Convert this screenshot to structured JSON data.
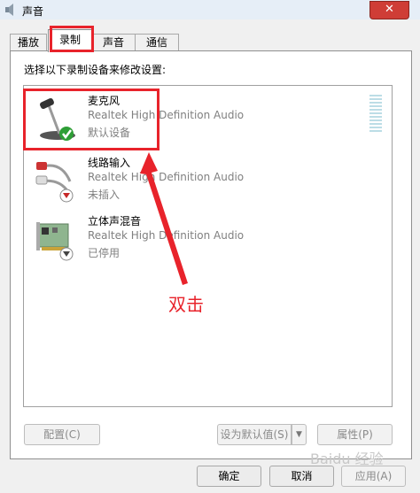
{
  "window": {
    "title": "声音",
    "close_label": "✕"
  },
  "tabs": [
    {
      "label": "播放"
    },
    {
      "label": "录制"
    },
    {
      "label": "声音"
    },
    {
      "label": "通信"
    }
  ],
  "panel": {
    "instruction": "选择以下录制设备来修改设置:"
  },
  "devices": [
    {
      "name": "麦克风",
      "driver": "Realtek High Definition Audio",
      "status": "默认设备"
    },
    {
      "name": "线路输入",
      "driver": "Realtek High Definition Audio",
      "status": "未插入"
    },
    {
      "name": "立体声混音",
      "driver": "Realtek High Definition Audio",
      "status": "已停用"
    }
  ],
  "buttons": {
    "configure": "配置(C)",
    "set_default": "设为默认值(S)",
    "properties": "属性(P)",
    "ok": "确定",
    "cancel": "取消",
    "apply": "应用(A)"
  },
  "annotation": {
    "text": "双击",
    "color": "#e8232b"
  },
  "watermark": "Baidu 经验"
}
